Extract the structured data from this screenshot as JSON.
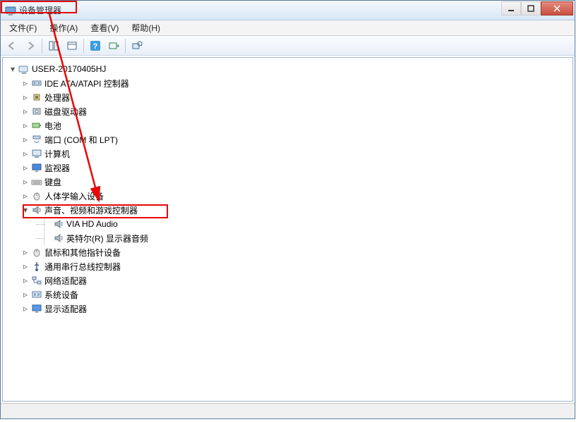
{
  "window": {
    "title": "设备管理器"
  },
  "menu": {
    "file": "文件(F)",
    "action": "操作(A)",
    "view": "查看(V)",
    "help": "帮助(H)"
  },
  "root": {
    "label": "USER-20170405HJ"
  },
  "categories": [
    {
      "label": "IDE ATA/ATAPI 控制器",
      "icon": "ide"
    },
    {
      "label": "处理器",
      "icon": "cpu"
    },
    {
      "label": "磁盘驱动器",
      "icon": "disk"
    },
    {
      "label": "电池",
      "icon": "battery"
    },
    {
      "label": "端口 (COM 和 LPT)",
      "icon": "port"
    },
    {
      "label": "计算机",
      "icon": "computer"
    },
    {
      "label": "监视器",
      "icon": "monitor"
    },
    {
      "label": "键盘",
      "icon": "keyboard"
    },
    {
      "label": "人体学输入设备",
      "icon": "hid"
    }
  ],
  "sound": {
    "label": "声音、视频和游戏控制器",
    "children": [
      "VIA HD Audio",
      "英特尔(R) 显示器音频"
    ]
  },
  "categories2": [
    {
      "label": "鼠标和其他指针设备",
      "icon": "mouse"
    },
    {
      "label": "通用串行总线控制器",
      "icon": "usb"
    },
    {
      "label": "网络适配器",
      "icon": "network"
    },
    {
      "label": "系统设备",
      "icon": "system"
    },
    {
      "label": "显示适配器",
      "icon": "display"
    }
  ]
}
